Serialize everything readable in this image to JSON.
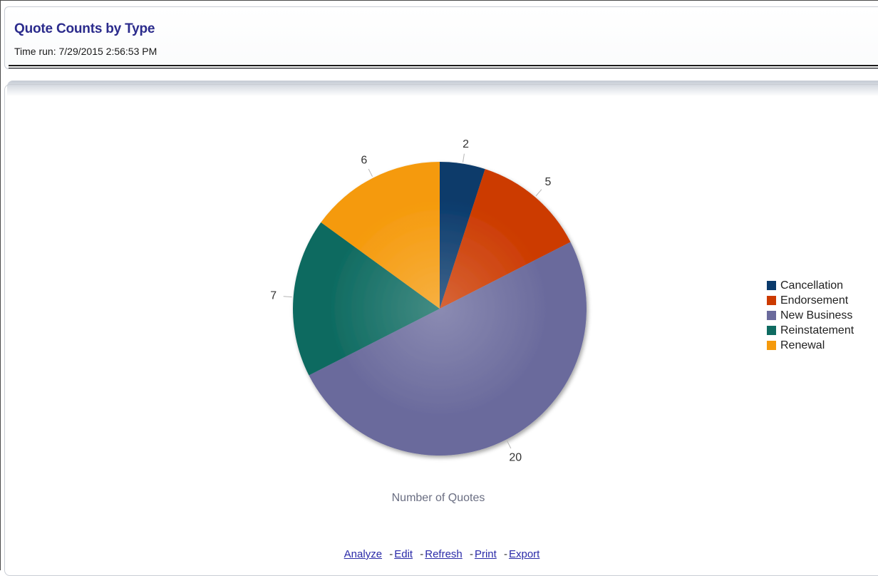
{
  "report": {
    "title": "Quote Counts by Type",
    "time_run": "Time run: 7/29/2015 2:56:53 PM"
  },
  "chart_data": {
    "type": "pie",
    "categories": [
      "Cancellation",
      "Endorsement",
      "New Business",
      "Reinstatement",
      "Renewal"
    ],
    "values": [
      2,
      5,
      20,
      7,
      6
    ],
    "colors": [
      "#0a3a6b",
      "#cc3a00",
      "#6a6a9c",
      "#0f6b61",
      "#f59a0c"
    ],
    "xlabel": "Number of Quotes",
    "legend_position": "right"
  },
  "actions": {
    "analyze": "Analyze",
    "edit": "Edit",
    "refresh": "Refresh",
    "print": "Print",
    "export": "Export",
    "separator": "-"
  }
}
